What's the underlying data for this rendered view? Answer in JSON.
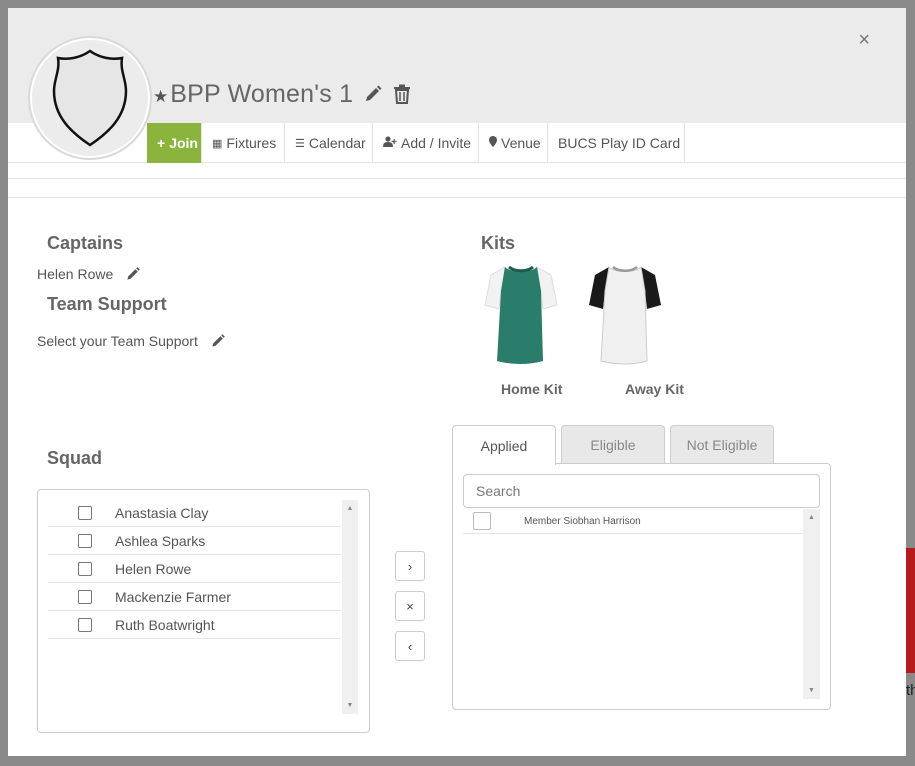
{
  "modal": {
    "team_name": "BPP Women's 1",
    "close_label": "×"
  },
  "tabs": [
    {
      "label": "Join",
      "icon": "plus-icon"
    },
    {
      "label": "Fixtures",
      "icon": "calendar-icon"
    },
    {
      "label": "Calendar",
      "icon": "list-icon"
    },
    {
      "label": "Add / Invite",
      "icon": "user-plus-icon"
    },
    {
      "label": "Venue",
      "icon": "map-pin-icon"
    },
    {
      "label": "BUCS Play ID Card",
      "icon": ""
    }
  ],
  "captains": {
    "title": "Captains",
    "name": "Helen Rowe"
  },
  "team_support": {
    "title": "Team Support",
    "placeholder": "Select your Team Support"
  },
  "kits": {
    "title": "Kits",
    "items": [
      {
        "label": "Home Kit",
        "body_color": "#2a7c6b",
        "sleeve_color": "#f2f2f2"
      },
      {
        "label": "Away Kit",
        "body_color": "#f0f0f0",
        "sleeve_color": "#1a1a1a"
      }
    ]
  },
  "squad": {
    "title": "Squad",
    "members": [
      "Anastasia Clay",
      "Ashlea Sparks",
      "Helen Rowe",
      "Mackenzie Farmer",
      "Ruth Boatwright"
    ]
  },
  "move_buttons": {
    "add": "›",
    "remove": "×",
    "back": "‹"
  },
  "player_tabs": {
    "tabs": [
      "Applied",
      "Eligible",
      "Not Eligible"
    ],
    "active": "Applied",
    "search_placeholder": "Search",
    "applied": [
      "Member Siobhan Harrison"
    ]
  },
  "colors": {
    "join_green": "#8bb43d",
    "header_grey": "#ebebeb"
  }
}
